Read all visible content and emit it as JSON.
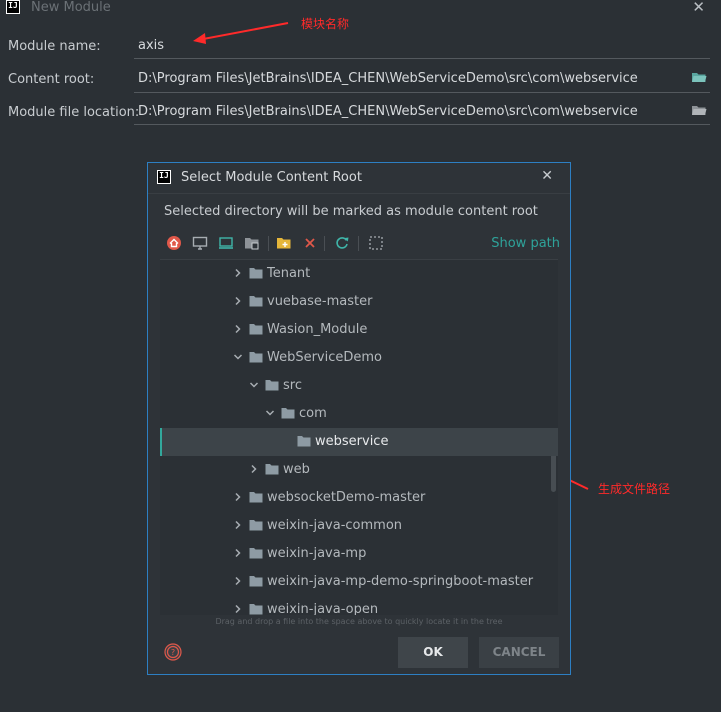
{
  "window": {
    "icon_text": "IJ",
    "title": "New Module",
    "close_glyph": "✕"
  },
  "form": {
    "module_name": {
      "label": "Module name:",
      "value": "axis"
    },
    "content_root": {
      "label": "Content root:",
      "value": "D:\\Program Files\\JetBrains\\IDEA_CHEN\\WebServiceDemo\\src\\com\\webservice"
    },
    "module_file_location": {
      "label": "Module file location:",
      "value": "D:\\Program Files\\JetBrains\\IDEA_CHEN\\WebServiceDemo\\src\\com\\webservice"
    }
  },
  "annotations": {
    "module_name_note": "模块名称",
    "path_note": "生成文件路径",
    "color": "#ff2a2a"
  },
  "dialog": {
    "icon_text": "IJ",
    "title": "Select Module Content Root",
    "close_glyph": "✕",
    "description": "Selected directory will be marked as module content root",
    "show_path": "Show path",
    "toolbar_icons": [
      "home-icon",
      "desktop-icon",
      "project-icon",
      "module-icon",
      "new-folder-icon",
      "delete-icon",
      "refresh-icon",
      "select-hidden-icon"
    ],
    "tree": [
      {
        "name": "Tenant",
        "level": 0,
        "expanded": false,
        "selected": false
      },
      {
        "name": "vuebase-master",
        "level": 0,
        "expanded": false,
        "selected": false
      },
      {
        "name": "Wasion_Module",
        "level": 0,
        "expanded": false,
        "selected": false
      },
      {
        "name": "WebServiceDemo",
        "level": 0,
        "expanded": true,
        "selected": false
      },
      {
        "name": "src",
        "level": 1,
        "expanded": true,
        "selected": false
      },
      {
        "name": "com",
        "level": 2,
        "expanded": true,
        "selected": false
      },
      {
        "name": "webservice",
        "level": 3,
        "expanded": null,
        "selected": true
      },
      {
        "name": "web",
        "level": 1,
        "expanded": false,
        "selected": false
      },
      {
        "name": "websocketDemo-master",
        "level": 0,
        "expanded": false,
        "selected": false
      },
      {
        "name": "weixin-java-common",
        "level": 0,
        "expanded": false,
        "selected": false
      },
      {
        "name": "weixin-java-mp",
        "level": 0,
        "expanded": false,
        "selected": false
      },
      {
        "name": "weixin-java-mp-demo-springboot-master",
        "level": 0,
        "expanded": false,
        "selected": false
      },
      {
        "name": "weixin-java-open",
        "level": 0,
        "expanded": false,
        "selected": false
      }
    ],
    "hint": "Drag and drop a file into the space above to quickly locate it in the tree",
    "ok_label": "OK",
    "cancel_label": "CANCEL"
  },
  "colors": {
    "accent": "#2ea39a",
    "dialog_border": "#2d7fc3",
    "background": "#2b3035"
  }
}
